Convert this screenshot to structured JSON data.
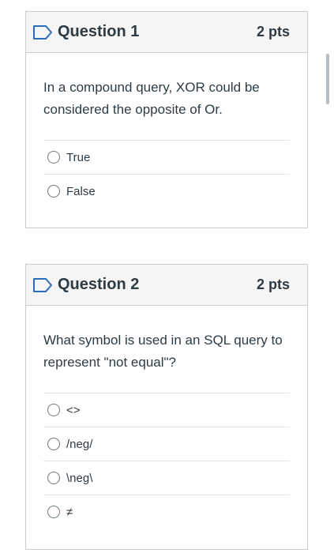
{
  "questions": [
    {
      "title": "Question 1",
      "points": "2 pts",
      "text": "In a compound query, XOR could be considered the opposite of Or.",
      "answers": [
        "True",
        "False"
      ]
    },
    {
      "title": "Question 2",
      "points": "2 pts",
      "text": "What symbol is used in an SQL query to represent \"not equal\"?",
      "answers": [
        "<>",
        "/neg/",
        "\\neg\\",
        "≠"
      ]
    }
  ],
  "colors": {
    "text": "#2d3b45",
    "border": "#c7cdd1",
    "header_bg": "#f5f5f5",
    "flag_stroke": "#2d6fb7"
  },
  "icons": {
    "question_flag": "bookmark-flag-icon",
    "answer_option": "radio-unchecked-icon"
  }
}
